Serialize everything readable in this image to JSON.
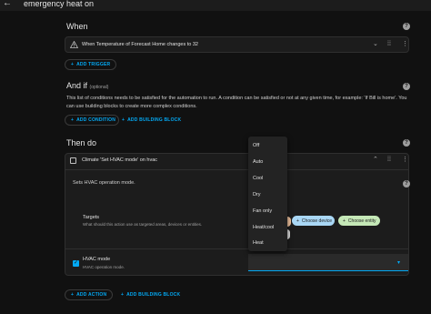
{
  "header": {
    "title": "emergency heat on",
    "back_icon": "arrow-left-icon"
  },
  "when": {
    "heading": "When",
    "trigger_text": "When Temperature of Forecast Home changes to 32",
    "add_trigger": "ADD TRIGGER"
  },
  "andif": {
    "heading": "And if",
    "optional": "(optional)",
    "description": "This list of conditions needs to be satisfied for the automation to run. A condition can be satisfied or not at any given time, for example: 'If Bill is home'. You can use building blocks to create more complex conditions.",
    "add_condition": "ADD CONDITION",
    "add_building_block": "ADD BUILDING BLOCK"
  },
  "thendo": {
    "heading": "Then do",
    "action_title": "Climate 'Set HVAC mode' on hvac",
    "action_desc": "Sets HVAC operation mode.",
    "targets_label": "Targets",
    "targets_help": "What should this action use as targeted areas, devices or entities.",
    "choose_device": "Choose device",
    "choose_entity": "Choose entity",
    "hvac_label": "HVAC mode",
    "hvac_help": "HVAC operation mode.",
    "add_action": "ADD ACTION",
    "add_building_block": "ADD BUILDING BLOCK"
  },
  "hvac_menu": {
    "options": [
      "Off",
      "Auto",
      "Cool",
      "Dry",
      "Fan only",
      "Heat/cool",
      "Heat"
    ]
  },
  "colors": {
    "accent": "#03a9f4",
    "device_chip": "#a9d7f5",
    "entity_chip": "#c5e8b7",
    "area_chip": "#f5c6a0"
  }
}
